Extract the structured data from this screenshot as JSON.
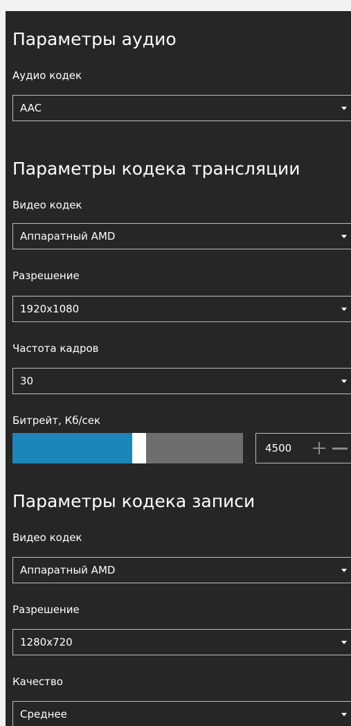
{
  "audio": {
    "title": "Параметры аудио",
    "codec_label": "Аудио кодек",
    "codec_value": "AAC"
  },
  "stream": {
    "title": "Параметры кодека трансляции",
    "video_codec_label": "Видео кодек",
    "video_codec_value": "Аппаратный AMD",
    "resolution_label": "Разрешение",
    "resolution_value": "1920x1080",
    "framerate_label": "Частота кадров",
    "framerate_value": "30",
    "bitrate_label": "Битрейт, Кб/сек",
    "bitrate_value": "4500",
    "bitrate_slider_fraction": 0.52,
    "slider_fill_color": "#1c85b9",
    "slider_track_color": "#6e6e6e",
    "plus_icon": "plus-icon",
    "minus_icon": "minus-icon"
  },
  "record": {
    "title": "Параметры кодека записи",
    "video_codec_label": "Видео кодек",
    "video_codec_value": "Аппаратный AMD",
    "resolution_label": "Разрешение",
    "resolution_value": "1280x720",
    "quality_label": "Качество",
    "quality_value": "Среднее"
  }
}
